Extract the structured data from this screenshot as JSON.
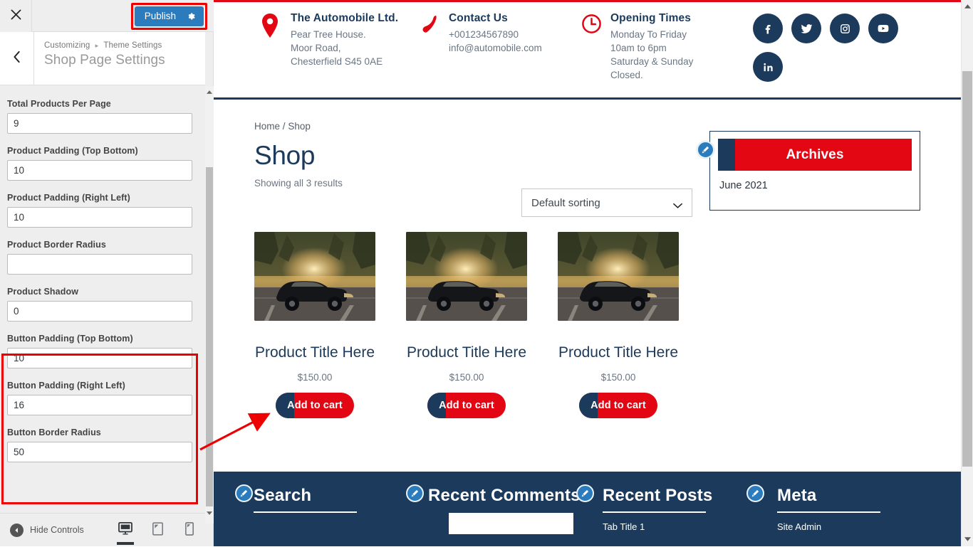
{
  "customizer": {
    "close_icon": "close-x-icon",
    "publish_label": "Publish",
    "publish_gear_icon": "gear-icon",
    "back_icon": "chevron-left-icon",
    "breadcrumb_root": "Customizing",
    "breadcrumb_sep": "▸",
    "breadcrumb_parent": "Theme Settings",
    "panel_title": "Shop Page Settings",
    "fields": [
      {
        "label": "Total Products Per Page",
        "value": "9"
      },
      {
        "label": "Product Padding (Top Bottom)",
        "value": "10"
      },
      {
        "label": "Product Padding (Right Left)",
        "value": "10"
      },
      {
        "label": "Product Border Radius",
        "value": ""
      },
      {
        "label": "Product Shadow",
        "value": "0"
      },
      {
        "label": "Button Padding (Top Bottom)",
        "value": "10"
      },
      {
        "label": "Button Padding (Right Left)",
        "value": "16"
      },
      {
        "label": "Button Border Radius",
        "value": "50"
      }
    ],
    "hide_controls_label": "Hide Controls",
    "devices": [
      {
        "name": "desktop",
        "active": true
      },
      {
        "name": "tablet",
        "active": false
      },
      {
        "name": "mobile",
        "active": false
      }
    ],
    "highlight_color": "#ee0000",
    "publish_bg": "#2b7bbd"
  },
  "site": {
    "accent_red": "#e30613",
    "navy": "#1b3a5c",
    "header": {
      "blocks": [
        {
          "icon": "location-pin-icon",
          "title": "The Automobile Ltd.",
          "lines": [
            "Pear Tree House.",
            "Moor Road,",
            "Chesterfield S45 0AE"
          ]
        },
        {
          "icon": "phone-icon",
          "title": "Contact Us",
          "lines": [
            "+001234567890",
            "info@automobile.com"
          ]
        },
        {
          "icon": "clock-icon",
          "title": "Opening Times",
          "lines": [
            "Monday To Friday",
            "10am to 6pm",
            "Saturday & Sunday",
            "Closed."
          ]
        }
      ],
      "socials": [
        "facebook-icon",
        "twitter-icon",
        "instagram-icon",
        "youtube-icon",
        "linkedin-icon"
      ]
    },
    "shop": {
      "breadcrumb_home": "Home",
      "breadcrumb_divider": "/",
      "breadcrumb_current": "Shop",
      "title": "Shop",
      "results": "Showing all 3 results",
      "sorting_value": "Default sorting",
      "products": [
        {
          "title": "Product Title Here",
          "price": "$150.00",
          "button": "Add to cart"
        },
        {
          "title": "Product Title Here",
          "price": "$150.00",
          "button": "Add to cart"
        },
        {
          "title": "Product Title Here",
          "price": "$150.00",
          "button": "Add to cart"
        }
      ]
    },
    "sidebar_widget": {
      "title": "Archives",
      "items": [
        "June 2021"
      ]
    },
    "footer": {
      "columns": [
        {
          "title": "Search",
          "items": []
        },
        {
          "title": "Recent Comments",
          "items": []
        },
        {
          "title": "Recent Posts",
          "items": [
            "Tab Title 1"
          ]
        },
        {
          "title": "Meta",
          "items": [
            "Site Admin"
          ]
        }
      ]
    }
  }
}
